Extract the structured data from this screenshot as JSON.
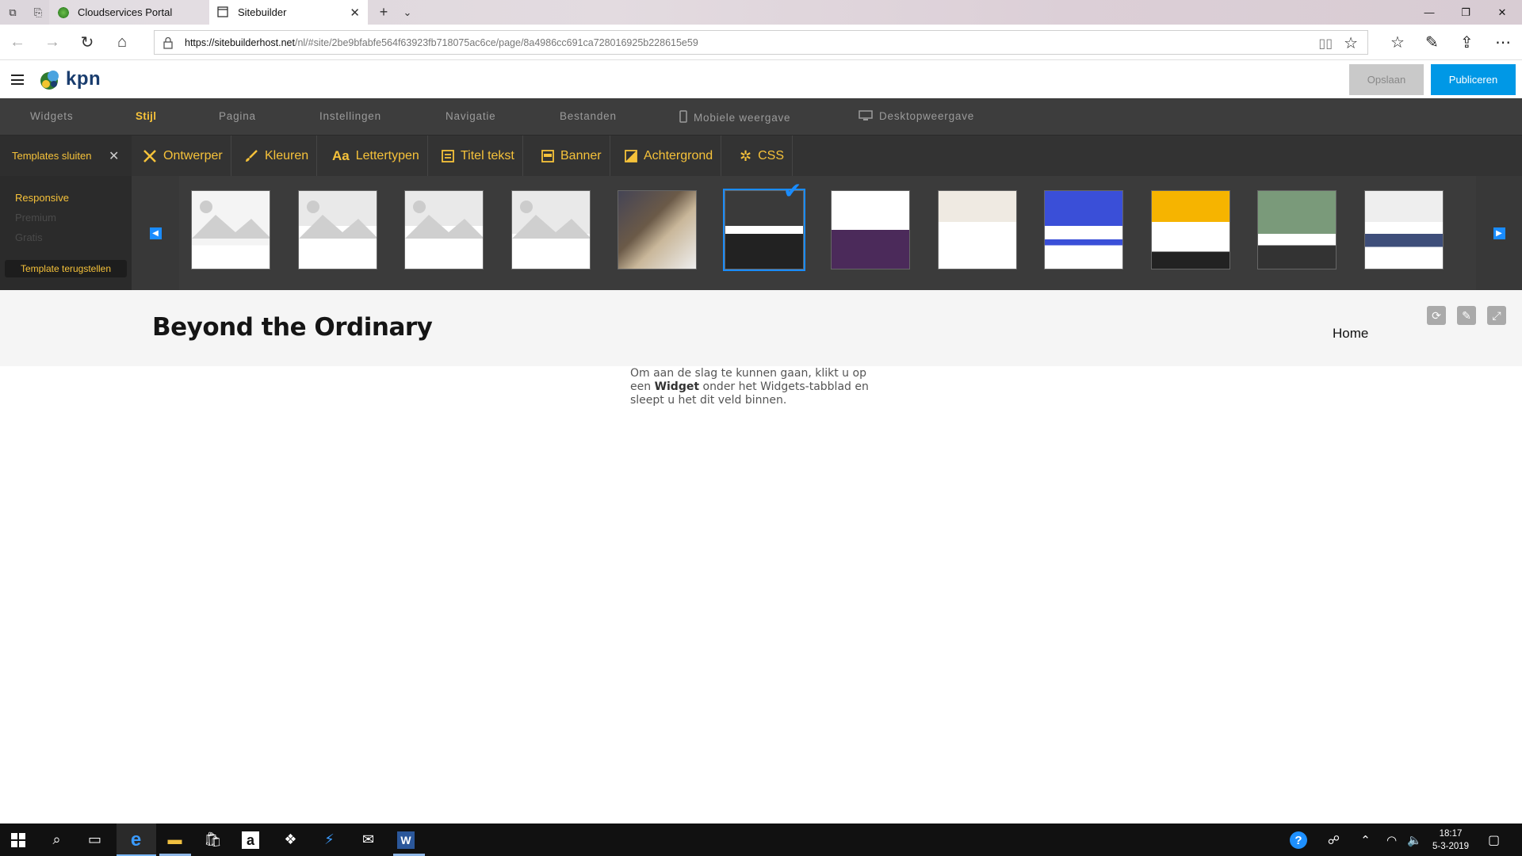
{
  "browser": {
    "tabs": [
      {
        "title": "Cloudservices Portal"
      },
      {
        "title": "Sitebuilder"
      }
    ],
    "url_host": "https://sitebuilderhost.net",
    "url_path": "/nl/#site/2be9bfabfe564f63923fb718075ac6ce/page/8a4986cc691ca728016925b228615e59"
  },
  "app": {
    "brand": "kpn",
    "save_label": "Opslaan",
    "publish_label": "Publiceren",
    "nav": [
      "Widgets",
      "Stijl",
      "Pagina",
      "Instellingen",
      "Navigatie",
      "Bestanden",
      "Mobiele weergave",
      "Desktopweergave"
    ],
    "active_nav": "Stijl",
    "templates_close": "Templates sluiten",
    "style_tools": [
      "Ontwerper",
      "Kleuren",
      "Lettertypen",
      "Titel tekst",
      "Banner",
      "Achtergrond",
      "CSS"
    ],
    "template_categories": [
      "Responsive",
      "Premium",
      "Gratis"
    ],
    "template_reset": "Template terugstellen",
    "template_count": 12,
    "selected_template_index": 5
  },
  "site": {
    "title": "Beyond the Ordinary",
    "nav_home": "Home",
    "intro_before": "Om aan de slag te kunnen gaan, klikt u op een ",
    "intro_bold": "Widget",
    "intro_after": " onder het Widgets-tabblad en sleept u het dit veld binnen."
  },
  "taskbar": {
    "time": "18:17",
    "date": "5-3-2019"
  },
  "colors": {
    "accent_yellow": "#f6c23a",
    "publish_blue": "#0098e6",
    "nav_bg": "#3d3d3d"
  }
}
